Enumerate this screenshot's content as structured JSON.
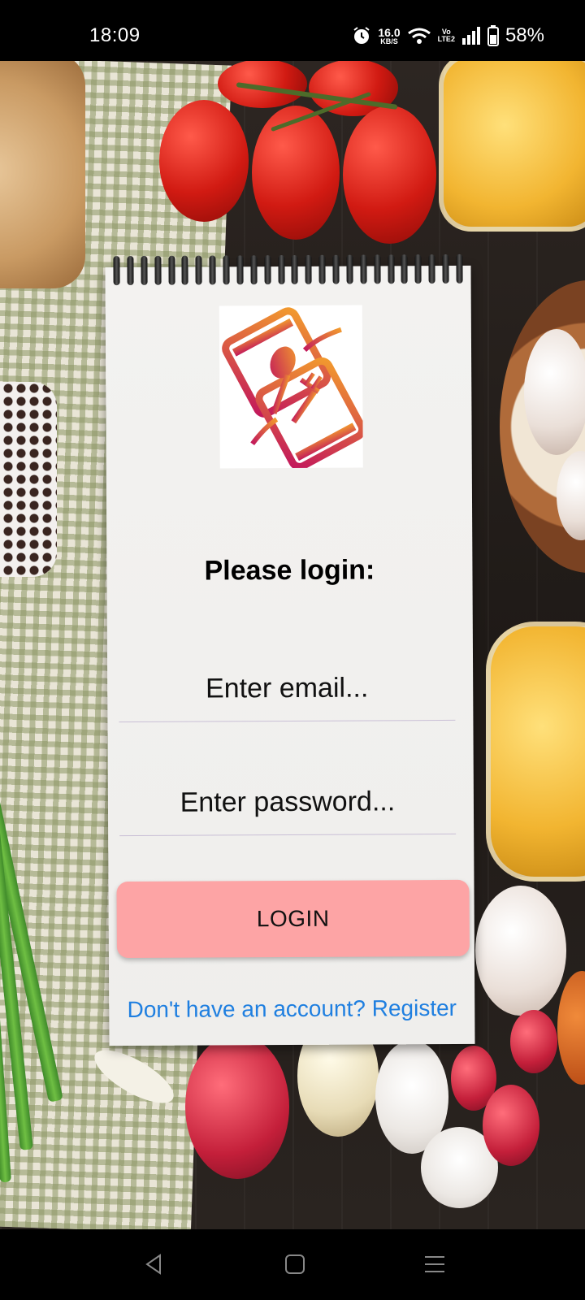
{
  "status_bar": {
    "time": "18:09",
    "net_speed_value": "16.0",
    "net_speed_unit": "KB/S",
    "volte_top": "Vo",
    "volte_bottom": "LTE2",
    "battery": "58%",
    "icons": [
      "alarm-icon",
      "wifi-icon",
      "volte-icon",
      "signal-icon",
      "battery-icon"
    ]
  },
  "login": {
    "title": "Please login:",
    "email_placeholder": "Enter email...",
    "password_placeholder": "Enter password...",
    "login_button": "LOGIN",
    "register_link": "Don't have an account? Register"
  },
  "colors": {
    "login_button": "#fda4a5",
    "register_link": "#1f7fe0",
    "logo_gradient_start": "#f29a2e",
    "logo_gradient_end": "#c2185b"
  },
  "nav_bar": {
    "icons": [
      "back-icon",
      "home-icon",
      "menu-icon"
    ]
  }
}
